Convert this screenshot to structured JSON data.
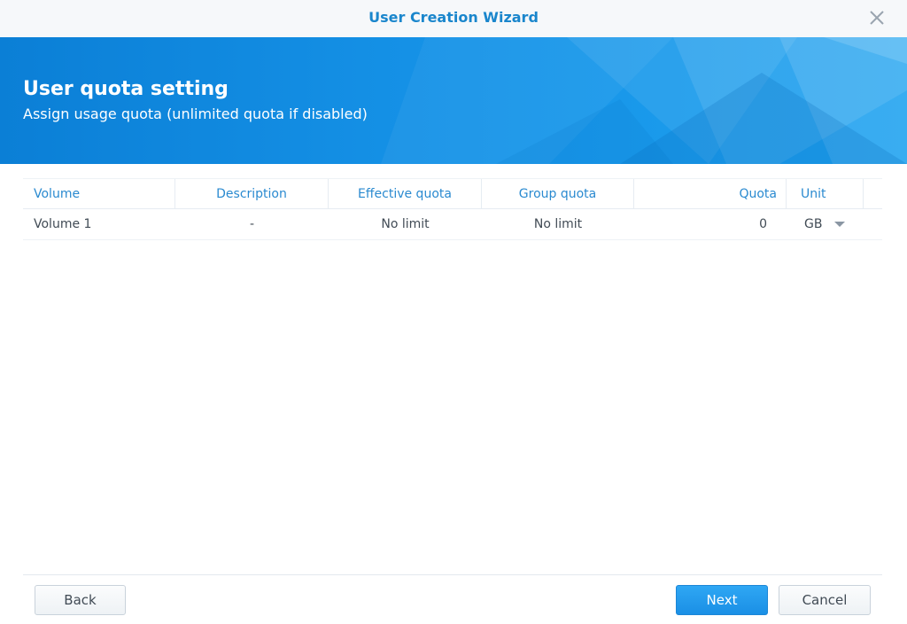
{
  "window": {
    "title": "User Creation Wizard",
    "close_icon": "close-icon"
  },
  "banner": {
    "title": "User quota setting",
    "subtitle": "Assign usage quota (unlimited quota if disabled)"
  },
  "grid": {
    "columns": {
      "volume": "Volume",
      "description": "Description",
      "effective_quota": "Effective quota",
      "group_quota": "Group quota",
      "quota": "Quota",
      "unit": "Unit"
    },
    "rows": [
      {
        "volume": "Volume 1",
        "description": "-",
        "effective_quota": "No limit",
        "group_quota": "No limit",
        "quota": "0",
        "unit": "GB"
      }
    ]
  },
  "footer": {
    "back_label": "Back",
    "next_label": "Next",
    "cancel_label": "Cancel"
  },
  "colors": {
    "accent": "#1a86cc",
    "banner": "#1591e6",
    "primary_button": "#1a8fe5"
  }
}
